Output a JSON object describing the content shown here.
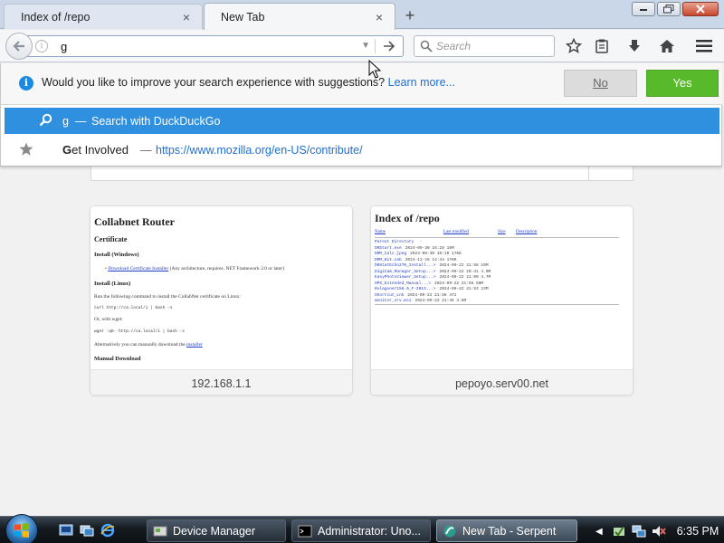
{
  "tabs": [
    {
      "label": "Index of /repo",
      "active": false
    },
    {
      "label": "New Tab",
      "active": true
    }
  ],
  "urlbar": {
    "value": "g"
  },
  "searchbar": {
    "placeholder": "Search"
  },
  "suggestion_banner": {
    "question": "Would you like to improve your search experience with suggestions?",
    "learn_more": "Learn more...",
    "no_label": "No",
    "yes_label": "Yes"
  },
  "autocomplete": {
    "search_row": {
      "typed": "g",
      "dash": "—",
      "action": "Search with DuckDuckGo"
    },
    "bookmark_row": {
      "title_bold": "G",
      "title_rest": "et Involved",
      "dash": "—",
      "url": "https://www.mozilla.org/en-US/contribute/"
    }
  },
  "tiles": [
    {
      "caption": "192.168.1.1",
      "thumb": {
        "title": "Collabnet Router",
        "certificate": "Certificate",
        "install_windows": "Install (Windows)",
        "download_link": "Download Certificate Installer",
        "download_note": "(Any architecture, requires .NET Framework 2.0 or later)",
        "install_linux": "Install (Linux)",
        "run_cmd_text": "Run the following command to install the CollabNet certificate on Linux:",
        "curl_cmd": "curl http://ca.local/i | bash -s",
        "or_wget": "Or, with wget:",
        "wget_cmd": "wget -qO- http://ca.local/i | bash -s",
        "alt_text": "Alternatively you can manually download the",
        "alt_link": "installer",
        "manual_download": "Manual Download"
      }
    },
    {
      "caption": "pepoyo.serv00.net",
      "thumb": {
        "title": "Index of /repo",
        "headers": [
          "Name",
          "Last modified",
          "Size",
          "Description"
        ],
        "rows": [
          {
            "name": "Parent Directory",
            "meta": "                              -"
          },
          {
            "name": "DRStart.exe",
            "meta": "2024-09-30 16:28   16M"
          },
          {
            "name": "DRM_Calc.jpeg",
            "meta": "2024-09-30 16:10  176K"
          },
          {
            "name": "DRM_Kit.cab",
            "meta": "2024-11-16 14:44  170K"
          },
          {
            "name": "DRStatEcho270_Install...>",
            "meta": "2024-09-22 21:58   10M"
          },
          {
            "name": "DigiCam_Manager_Setup...>",
            "meta": "2024-09-22 20:41  4.0M"
          },
          {
            "name": "EasyPhotoViewer_Setup...>",
            "meta": "2024-09-22 21:00  4.7M"
          },
          {
            "name": "HPS_Extended_Manual...>",
            "meta": "2024-09-22 21:55   60M"
          },
          {
            "name": "Rolagoner158.0_F-2013...>",
            "meta": "2024-09-22 21:53   23M"
          },
          {
            "name": "Shortcut_Lnk",
            "meta": "2024-09-22 21:58   471"
          },
          {
            "name": "monitor_srv.msi",
            "meta": "2024-09-22 21:45  4.8M"
          }
        ]
      }
    }
  ],
  "taskbar": {
    "tasks": [
      {
        "label": "Device Manager",
        "active": false
      },
      {
        "label": "Administrator:  Uno...",
        "active": false
      },
      {
        "label": "New Tab - Serpent",
        "active": true
      }
    ],
    "clock": "6:35 PM"
  },
  "colors": {
    "accent_blue": "#3090e0",
    "yes_green": "#58b92b",
    "link_blue": "#1f6fd0"
  }
}
